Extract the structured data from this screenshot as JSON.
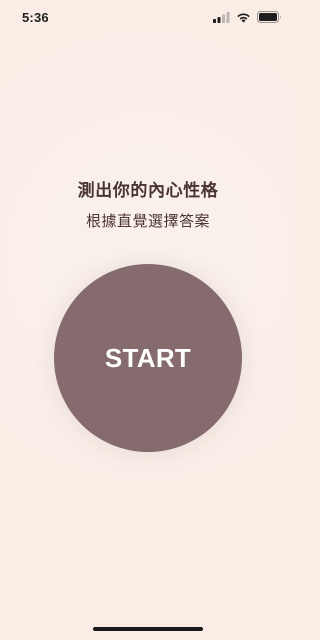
{
  "status_bar": {
    "time": "5:36",
    "icons": [
      "cellular-signal-icon",
      "wifi-icon",
      "battery-icon"
    ]
  },
  "main": {
    "title": "測出你的內心性格",
    "subtitle": "根據直覺選擇答案",
    "start_button_label": "START"
  },
  "colors": {
    "background": "#F9EDE6",
    "button": "#856A6E",
    "text": "#4A3432",
    "button_text": "#FFFFFF"
  }
}
